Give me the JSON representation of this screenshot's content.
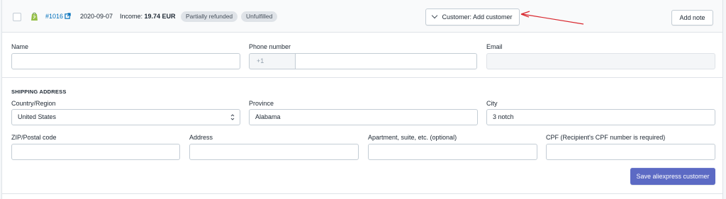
{
  "order": {
    "number": "#1016",
    "date": "2020-09-07",
    "income_label": "Income:",
    "income_value": "19.74 EUR",
    "badges": [
      "Partially refunded",
      "Unfulfilled"
    ]
  },
  "header": {
    "customer_button": "Customer: Add customer",
    "add_note_button": "Add note"
  },
  "form": {
    "name_label": "Name",
    "name_value": "",
    "phone_label": "Phone number",
    "phone_prefix": "+1",
    "phone_value": "",
    "email_label": "Email",
    "email_value": "",
    "shipping_title": "SHIPPING ADDRESS",
    "country_label": "Country/Region",
    "country_value": "United States",
    "province_label": "Province",
    "province_value": "Alabama",
    "city_label": "City",
    "city_value": "3 notch",
    "zip_label": "ZIP/Postal code",
    "zip_value": "",
    "address_label": "Address",
    "address_value": "",
    "apartment_label": "Apartment, suite, etc. (optional)",
    "apartment_value": "",
    "cpf_label": "CPF (Recipient's CPF number is required)",
    "cpf_value": ""
  },
  "actions": {
    "save_button": "Save aliexpress customer"
  },
  "colors": {
    "primary": "#5c6ac4",
    "link": "#006fbb",
    "shopify_green": "#95bf47",
    "annotation_red": "#d9282f"
  }
}
